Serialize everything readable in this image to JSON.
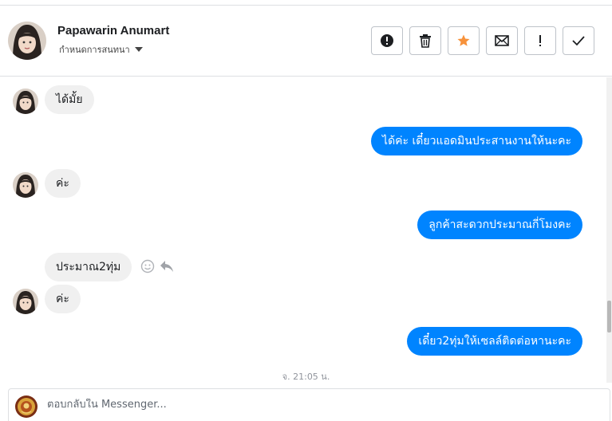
{
  "header": {
    "contact_name": "Papawarin Anumart",
    "contact_subtitle": "กำหนดการสนทนา",
    "actions": [
      {
        "name": "mark-spam",
        "icon": "alert-circle-icon"
      },
      {
        "name": "delete",
        "icon": "trash-icon"
      },
      {
        "name": "star",
        "icon": "star-icon"
      },
      {
        "name": "mark-unread",
        "icon": "envelope-icon"
      },
      {
        "name": "follow-up",
        "icon": "exclamation-icon"
      },
      {
        "name": "mark-done",
        "icon": "check-icon"
      }
    ]
  },
  "messages": [
    {
      "from": "contact",
      "text": "ได้มั้ย"
    },
    {
      "from": "page",
      "text": "ได้ค่ะ เดี๋ยวแอดมินประสานงานให้นะคะ"
    },
    {
      "from": "contact",
      "text": "ค่ะ"
    },
    {
      "from": "page",
      "text": "ลูกค้าสะดวกประมาณกี่โมงคะ"
    },
    {
      "from": "contact",
      "text": "ประมาณ2ทุ่ม"
    },
    {
      "from": "contact",
      "text": "ค่ะ"
    },
    {
      "from": "page",
      "text": "เดี๋ยว2ทุ่มให้เซลล์ติดต่อหานะคะ"
    }
  ],
  "timestamp": "จ. 21:05 น.",
  "composer": {
    "placeholder": "ตอบกลับใน Messenger..."
  },
  "colors": {
    "outgoing_bubble": "#0084ff",
    "incoming_bubble": "#f0f0f0",
    "star": "#f7923b"
  }
}
